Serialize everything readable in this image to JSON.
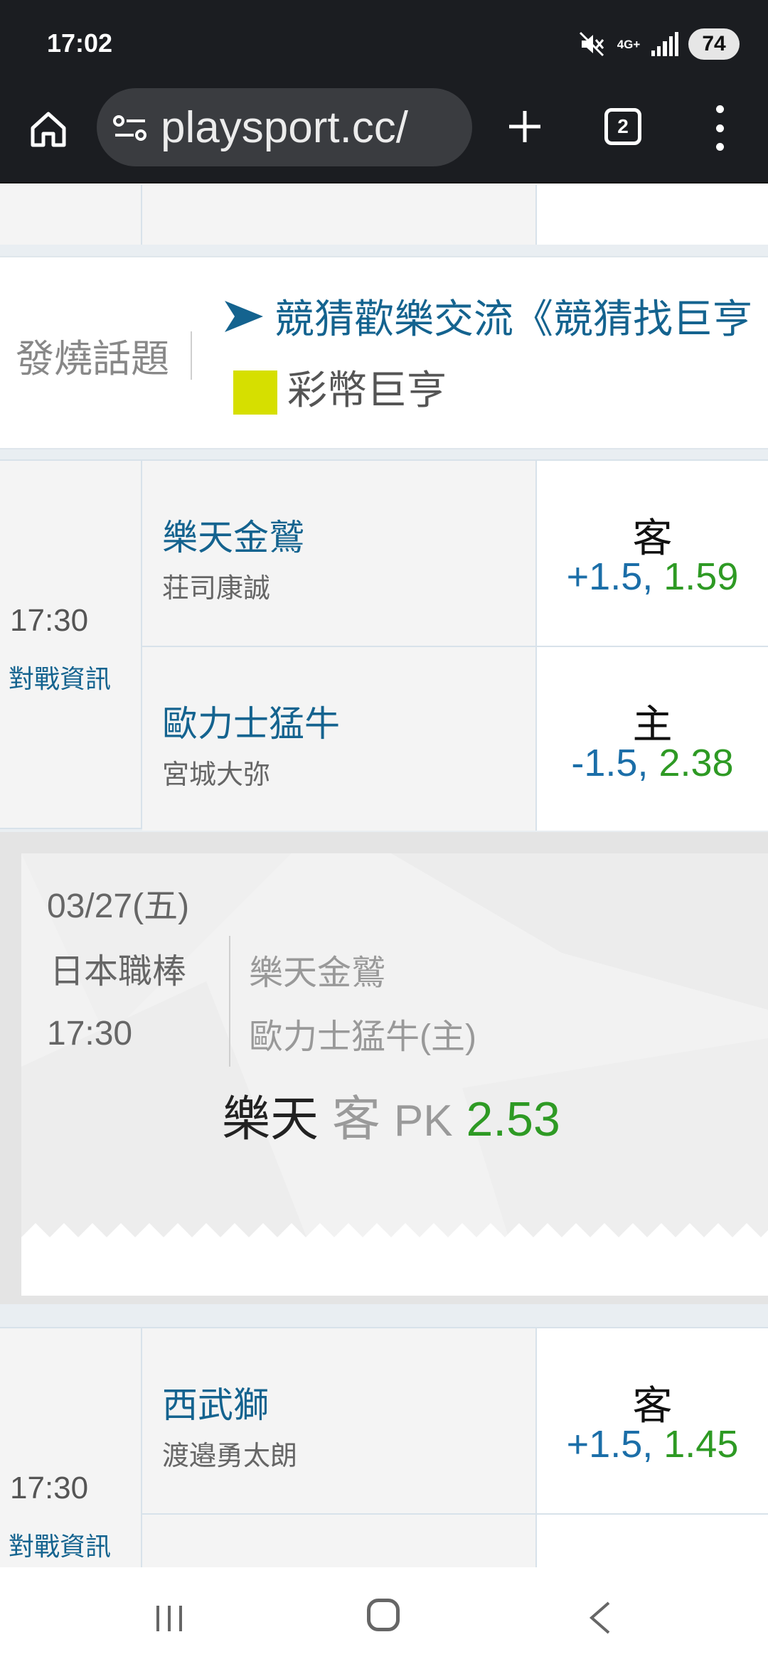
{
  "status_bar": {
    "time": "17:02",
    "network": "4G+",
    "battery": "74",
    "icons": [
      "mute-icon",
      "signal-icon"
    ]
  },
  "browser": {
    "url": "playsport.cc/",
    "tab_count": "2",
    "icons": [
      "home-icon",
      "tune-icon",
      "plus-icon",
      "menu-dots-icon"
    ]
  },
  "hot_topics": {
    "label": "發燒話題",
    "link": "競猜歡樂交流《競猜找巨亨",
    "tag": "彩幣巨亨",
    "tag_color": "#d6df00"
  },
  "games": [
    {
      "time": "17:30",
      "info_link": "對戰資訊",
      "away_team": "樂天金鷲",
      "away_pitcher": "荘司康誠",
      "away_side": "客",
      "away_spread": "+1.5,",
      "away_price": " 1.59",
      "home_team": "歐力士猛牛",
      "home_pitcher": "宮城大弥",
      "home_side": "主",
      "home_spread": "-1.5,",
      "home_price": " 2.38"
    },
    {
      "time": "17:30",
      "info_link": "對戰資訊",
      "away_team": "西武獅",
      "away_pitcher": "渡邉勇太朗",
      "away_side": "客",
      "away_spread": "+1.5,",
      "away_price": " 1.45"
    }
  ],
  "promo": {
    "date": "03/27(五)",
    "league": "日本職棒",
    "time": "17:30",
    "away_team": "樂天金鷲",
    "home_team": "歐力士猛牛(主)",
    "pick_team": "樂天",
    "pick_side": "客",
    "pick_type": "PK",
    "pick_odds": "2.53"
  },
  "colors": {
    "link_blue": "#14638f",
    "odds_green": "#2e9a24",
    "spread_blue": "#1b6ea8"
  }
}
